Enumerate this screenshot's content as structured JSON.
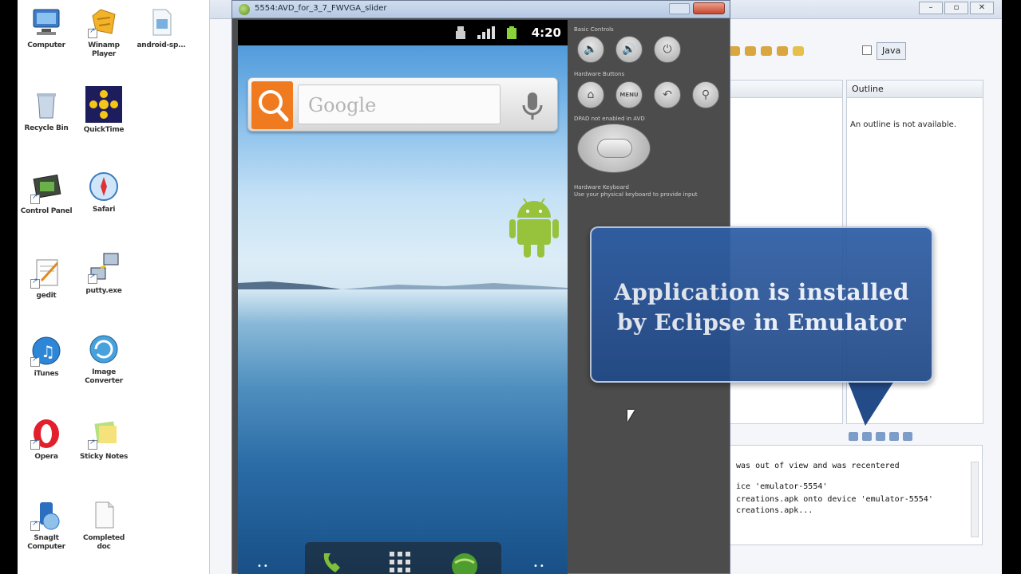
{
  "desktop": {
    "icons": [
      {
        "label": "Computer",
        "icon": "computer-icon"
      },
      {
        "label": "Recycle Bin",
        "icon": "recycle-bin-icon"
      },
      {
        "label": "Control Panel",
        "icon": "control-panel-icon"
      },
      {
        "label": "gedit",
        "icon": "notepad-icon"
      },
      {
        "label": "iTunes",
        "icon": "itunes-icon"
      },
      {
        "label": "Opera",
        "icon": "opera-icon"
      },
      {
        "label": "SnagIt Computer",
        "icon": "snagit-icon"
      },
      {
        "label": "Winamp Player",
        "icon": "winamp-icon"
      },
      {
        "label": "QuickTime",
        "icon": "quicktime-icon"
      },
      {
        "label": "Safari",
        "icon": "safari-icon"
      },
      {
        "label": "putty.exe",
        "icon": "putty-icon"
      },
      {
        "label": "Image Converter",
        "icon": "image-converter-icon"
      },
      {
        "label": "Sticky Notes",
        "icon": "sticky-notes-icon"
      },
      {
        "label": "Completed doc",
        "icon": "document-icon"
      },
      {
        "label": "android-sp...",
        "icon": "android-sdk-icon"
      }
    ]
  },
  "emulator": {
    "title": "5554:AVD_for_3_7_FWVGA_slider",
    "status_time": "4:20",
    "search_placeholder": "Google",
    "controls": {
      "basic_label": "Basic Controls",
      "hardware_label": "Hardware Buttons",
      "dpad_label": "DPAD not enabled in AVD",
      "keyboard_label": "Hardware Keyboard",
      "keyboard_hint": "Use your physical keyboard to provide input",
      "menu_label": "MENU"
    }
  },
  "eclipse": {
    "perspective": "Java",
    "outline_tab": "Outline",
    "outline_message": "An outline is not available.",
    "console_lines": [
      "was out of view and was recentered",
      "ice 'emulator-5554'",
      "creations.apk onto device 'emulator-5554'",
      "creations.apk..."
    ]
  },
  "callout": {
    "line1": "Application is installed",
    "line2": "by Eclipse in Emulator"
  }
}
